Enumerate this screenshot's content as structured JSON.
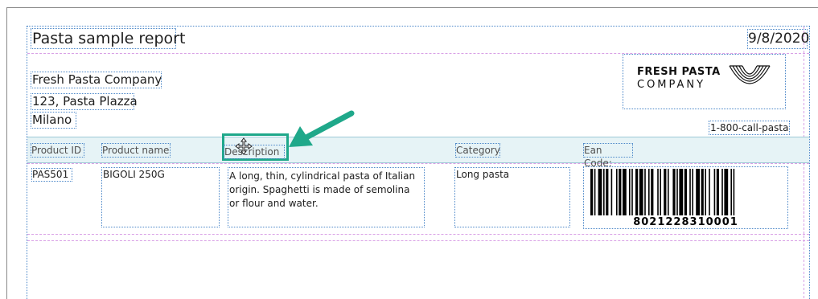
{
  "report": {
    "title": "Pasta sample report",
    "date": "9/8/2020",
    "company": {
      "name": "Fresh Pasta Company",
      "address": "123, Pasta Plazza",
      "city": "Milano"
    },
    "logo": {
      "line1": "FRESH PASTA",
      "line2": "COMPANY"
    },
    "phone": "1-800-call-pasta",
    "columns": {
      "product_id": "Product ID",
      "product_name": "Product name",
      "description": "Description",
      "category": "Category",
      "ean_code": "Ean Code:"
    },
    "row": {
      "product_id": "PAS501",
      "product_name": "BIGOLI 250G",
      "description": "A long, thin, cylindrical pasta of Italian origin. Spaghetti is made of semolina or flour and water.",
      "category": "Long pasta",
      "ean_code": "8021228310001"
    }
  },
  "colors": {
    "arrow": "#1fa88a",
    "highlight_border": "#1fa88a",
    "header_band": "#e6f3f6",
    "guide": "#d9a0e6",
    "frame": "#4a86c8"
  },
  "icons": {
    "cursor": "move-cursor-icon",
    "arrow": "annotation-arrow-icon"
  }
}
